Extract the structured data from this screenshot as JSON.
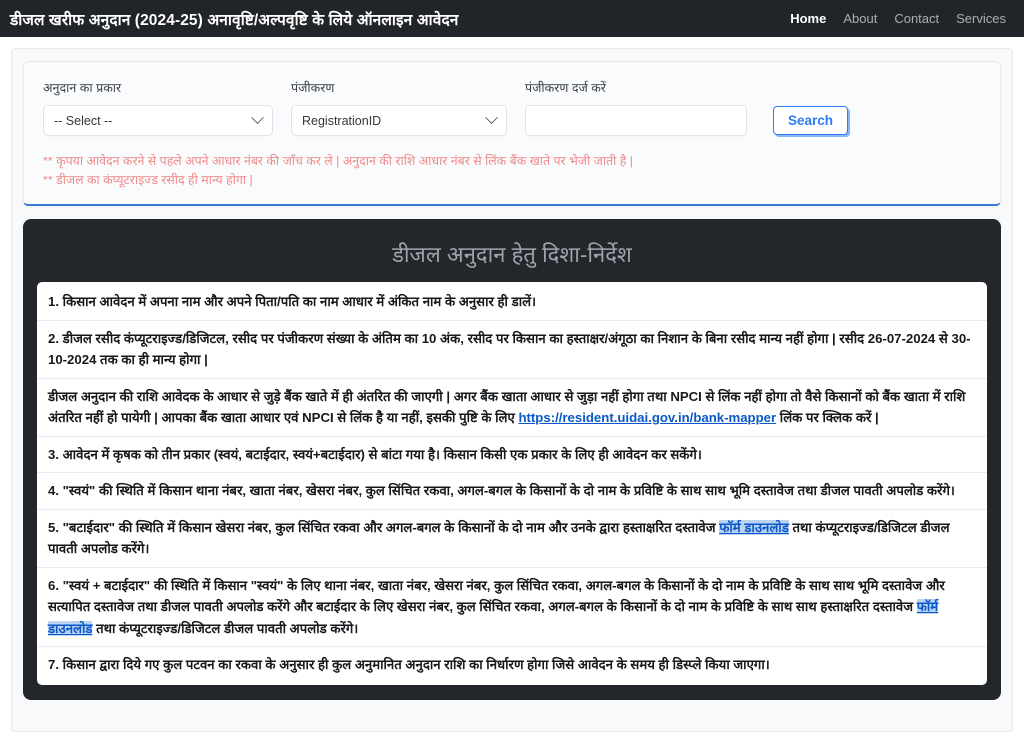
{
  "navbar": {
    "brand": "डीजल खरीफ अनुदान (2024-25) अनावृष्टि/अल्पवृष्टि के लिये ऑनलाइन आवेदन",
    "links": [
      {
        "label": "Home",
        "active": true
      },
      {
        "label": "About",
        "active": false
      },
      {
        "label": "Contact",
        "active": false
      },
      {
        "label": "Services",
        "active": false
      }
    ]
  },
  "search_form": {
    "grant_type": {
      "label": "अनुदान का प्रकार",
      "value": "-- Select --"
    },
    "registration": {
      "label": "पंजीकरण",
      "value": "RegistrationID"
    },
    "registration_entry": {
      "label": "पंजीकरण दर्ज करें",
      "value": "",
      "placeholder": ""
    },
    "search_button": "Search",
    "accent_color": "#2f7bf6"
  },
  "notices": {
    "color": "#f08a8a",
    "lines": [
      "** कृपया आवेदन करने से पहले अपने आधार नंबर की जाँच कर ले | अनुदान की राशि आधार नंबर से लिंक बैंक खाते पर भेजी जाती है |",
      "** डीजल का  कंप्यूटराइज्ड रसीद ही मान्य होगा |"
    ]
  },
  "guidelines": {
    "title": "डीजल अनुदान हेतु दिशा-निर्देश",
    "items": [
      {
        "id": "item-1",
        "text": "1. किसान आवेदन में अपना नाम और अपने पिता/पति का नाम आधार में अंकित नाम के अनुसार ही डालें।"
      },
      {
        "id": "item-2",
        "text": "2. डीजल रसीद कंप्यूटराइज्ड/डिजिटल, रसीद पर पंजीकरण संख्या के अंतिम का 10 अंक, रसीद पर किसान का हस्ताक्षर/अंगूठा का निशान के बिना रसीद मान्य नहीं होगा | रसीद 26-07-2024 से 30-10-2024 तक का ही मान्य होगा |"
      },
      {
        "id": "item-3",
        "text_before": "डीजल अनुदान की राशि आवेदक के आधार से जुड़े बैंक खाते में ही अंतरित की जाएगी | अगर बैंक खाता आधार से जुड़ा नहीं होगा तथा NPCI से लिंक नहीं होगा तो वैसे किसानों को बैंक खाता में राशि अंतरित नहीं हो पायेगी | आपका बैंक खाता आधार एवं NPCI से लिंक है या नहीं, इसकी पुष्टि के लिए ",
        "link": "https://resident.uidai.gov.in/bank-mapper",
        "text_after": " लिंक पर क्लिक करें |"
      },
      {
        "id": "item-4",
        "text": "3. आवेदन में कृषक को तीन प्रकार (स्वयं, बटाईदार, स्वयं+बटाईदार) से बांटा गया है। किसान किसी एक प्रकार के लिए ही आवेदन कर सकेंगे।"
      },
      {
        "id": "item-5",
        "text": "4. \"स्वयं\" की स्थिति में किसान थाना नंबर, खाता नंबर, खेसरा नंबर, कुल सिंचित रकवा, अगल-बगल के किसानों के दो नाम के प्रविष्टि के साथ साथ भूमि दस्तावेज तथा डीजल पावती अपलोड करेंगे।"
      },
      {
        "id": "item-6",
        "text_before": "5. \"बटाईदार\" की स्थिति में किसान खेसरा नंबर, कुल सिंचित रकवा और अगल-बगल के किसानों के दो नाम और उनके द्वारा हस्ताक्षरित दस्तावेज ",
        "link": "फॉर्म डाउनलोड",
        "text_after": " तथा कंप्यूटराइज्ड/डिजिटल डीजल पावती अपलोड करेंगे।"
      },
      {
        "id": "item-7",
        "text_before": "6. \"स्वयं + बटाईदार\" की स्थिति में किसान \"स्वयं\" के लिए थाना नंबर, खाता नंबर, खेसरा नंबर, कुल सिंचित रकवा, अगल-बगल के किसानों के दो नाम के प्रविष्टि के साथ साथ भूमि दस्तावेज और सत्यापित दस्तावेज तथा डीजल पावती अपलोड करेंगे और बटाईदार के लिए खेसरा नंबर, कुल सिंचित रकवा, अगल-बगल के किसानों के दो नाम के प्रविष्टि के साथ साथ हस्ताक्षरित दस्तावेज ",
        "link": "फॉर्म डाउनलोड",
        "text_after": " तथा कंप्यूटराइज्ड/डिजिटल डीजल पावती अपलोड करेंगे।"
      },
      {
        "id": "item-8",
        "text": "7. किसान द्वारा दिये गए कुल पटवन का रकवा के अनुसार ही कुल अनुमानित अनुदान राशि का निर्धारण होगा जिसे आवेदन के समय ही डिस्प्ले किया जाएगा।"
      }
    ]
  }
}
